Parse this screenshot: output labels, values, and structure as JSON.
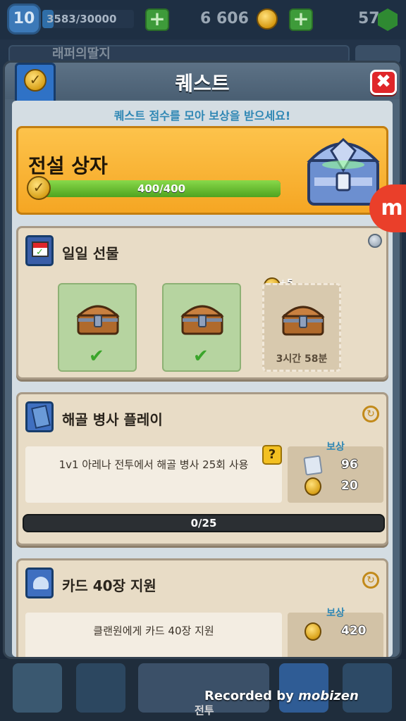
{
  "hud": {
    "level": "10",
    "xp": "3583/30000",
    "xp_fraction": 0.12,
    "gold": "6 606",
    "gems": "57",
    "clan_text": "래퍼의딸지"
  },
  "modal": {
    "title": "퀘스트",
    "subtitle": "퀘스트 점수를 모아 보상을 받으세요!",
    "close_label": "✖"
  },
  "banner": {
    "title": "전설 상자",
    "progress_text": "400/400",
    "progress_fraction": 1.0
  },
  "daily_gift": {
    "title": "일일 선물",
    "bonus": "+5",
    "slots": [
      {
        "state": "claimed",
        "check": "✔"
      },
      {
        "state": "claimed",
        "check": "✔"
      },
      {
        "state": "pending",
        "timer": "3시간 58분"
      }
    ]
  },
  "quest1": {
    "title": "해골 병사 플레이",
    "description": "1v1 아레나 전투에서 해골 병사 25회 사용",
    "help": "?",
    "reward_label": "보상",
    "reward_xp": "96",
    "reward_points": "20",
    "progress": "0/25"
  },
  "quest2": {
    "title": "카드 40장 지원",
    "description": "클랜원에게 카드 40장 지원",
    "reward_label": "보상",
    "reward_gold": "420"
  },
  "nav": {
    "active_label": "전투"
  },
  "overlay": {
    "recorded_prefix": "Recorded by",
    "recorded_brand": "mobizen",
    "fab": "m"
  },
  "colors": {
    "accent_gold": "#f5a623",
    "progress_green": "#4fa31f",
    "close_red": "#e0262a",
    "subtitle_blue": "#2f87b4"
  }
}
